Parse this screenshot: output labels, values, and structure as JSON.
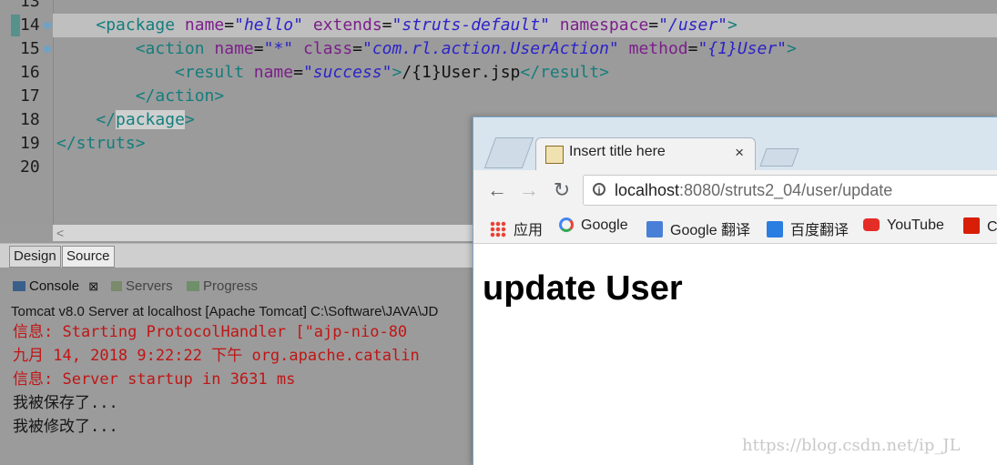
{
  "editor": {
    "line_numbers": [
      "13",
      "14",
      "15",
      "16",
      "17",
      "18",
      "19",
      "20"
    ],
    "lines": [
      {
        "indent": "    ",
        "parts": [
          [
            "tag",
            "<package "
          ],
          [
            "attr",
            "name"
          ],
          [
            "txt",
            "="
          ],
          [
            "val",
            "\"hello\""
          ],
          [
            "txt",
            " "
          ],
          [
            "attr",
            "extends"
          ],
          [
            "txt",
            "="
          ],
          [
            "val",
            "\"struts-default\""
          ],
          [
            "txt",
            " "
          ],
          [
            "attr",
            "namespace"
          ],
          [
            "txt",
            "="
          ],
          [
            "val",
            "\"/user\""
          ],
          [
            "tag",
            ">"
          ]
        ]
      },
      {
        "indent": "        ",
        "parts": [
          [
            "tag",
            "<action "
          ],
          [
            "attr",
            "name"
          ],
          [
            "txt",
            "="
          ],
          [
            "val",
            "\"*\""
          ],
          [
            "txt",
            " "
          ],
          [
            "attr",
            "class"
          ],
          [
            "txt",
            "="
          ],
          [
            "val",
            "\"com.rl.action.UserAction\""
          ],
          [
            "txt",
            " "
          ],
          [
            "attr",
            "method"
          ],
          [
            "txt",
            "="
          ],
          [
            "val",
            "\"{1}User\""
          ],
          [
            "tag",
            ">"
          ]
        ]
      },
      {
        "indent": "            ",
        "parts": [
          [
            "tag",
            "<result "
          ],
          [
            "attr",
            "name"
          ],
          [
            "txt",
            "="
          ],
          [
            "val",
            "\"success\""
          ],
          [
            "tag",
            ">"
          ],
          [
            "txt",
            "/{1}User.jsp"
          ],
          [
            "tag",
            "</result>"
          ]
        ]
      },
      {
        "indent": "        ",
        "parts": [
          [
            "tag",
            "</action>"
          ]
        ]
      },
      {
        "indent": "    ",
        "parts": [
          [
            "tag",
            "</"
          ],
          [
            "tag",
            "package"
          ],
          [
            "tag",
            ">"
          ]
        ]
      },
      {
        "indent": "",
        "parts": [
          [
            "tag",
            "</struts>"
          ]
        ]
      },
      {
        "indent": "",
        "parts": []
      }
    ]
  },
  "editor_tabs": {
    "design": "Design",
    "source": "Source"
  },
  "views": {
    "console": "Console",
    "servers": "Servers",
    "progress": "Progress"
  },
  "console": {
    "header": "Tomcat v8.0 Server at localhost [Apache Tomcat] C:\\Software\\JAVA\\JD",
    "lines": [
      {
        "color": "red",
        "text": "信息: Starting ProtocolHandler [\"ajp-nio-80"
      },
      {
        "color": "red",
        "text": "九月 14, 2018 9:22:22 下午 org.apache.catalin"
      },
      {
        "color": "red",
        "text": "信息: Server startup in 3631 ms"
      },
      {
        "color": "black",
        "text": "我被保存了..."
      },
      {
        "color": "black",
        "text": "我被修改了..."
      }
    ]
  },
  "browser": {
    "tab_title": "Insert title here",
    "tab_close": "×",
    "url_host": "localhost",
    "url_rest": ":8080/struts2_04/user/update",
    "bookmarks": [
      {
        "label": "应用",
        "icon": "apps-grid-icon"
      },
      {
        "label": "Google",
        "icon": "google-icon"
      },
      {
        "label": "Google 翻译",
        "icon": "google-translate-icon"
      },
      {
        "label": "百度翻译",
        "icon": "baidu-translate-icon"
      },
      {
        "label": "YouTube",
        "icon": "youtube-icon"
      },
      {
        "label": "C",
        "icon": "csdn-icon"
      }
    ],
    "page_heading": "update User"
  },
  "watermark": "https://blog.csdn.net/ip_JL"
}
